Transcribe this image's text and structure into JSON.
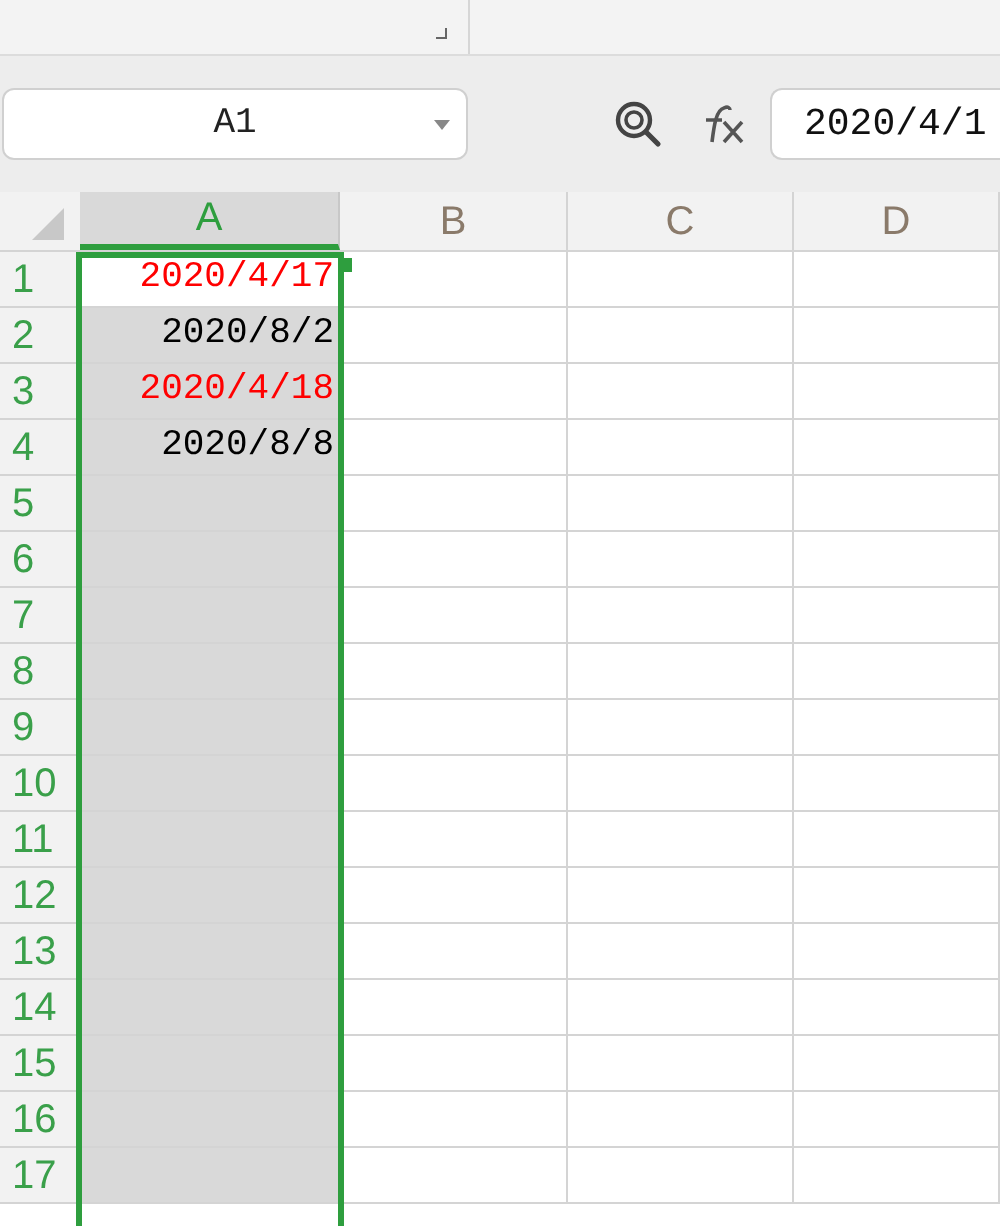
{
  "formula_bar": {
    "name_box": "A1",
    "formula": "2020/4/1"
  },
  "columns": [
    {
      "label": "A",
      "selected": true
    },
    {
      "label": "B",
      "selected": false
    },
    {
      "label": "C",
      "selected": false
    },
    {
      "label": "D",
      "selected": false
    }
  ],
  "rows": [
    {
      "header": "1",
      "cells": [
        {
          "text": "2020/4/17",
          "color": "#ff0000",
          "active": true
        }
      ]
    },
    {
      "header": "2",
      "cells": [
        {
          "text": "2020/8/2",
          "color": "#000000",
          "active": false
        }
      ]
    },
    {
      "header": "3",
      "cells": [
        {
          "text": "2020/4/18",
          "color": "#ff0000",
          "active": false
        }
      ]
    },
    {
      "header": "4",
      "cells": [
        {
          "text": "2020/8/8",
          "color": "#000000",
          "active": false
        }
      ]
    },
    {
      "header": "5"
    },
    {
      "header": "6"
    },
    {
      "header": "7"
    },
    {
      "header": "8"
    },
    {
      "header": "9"
    },
    {
      "header": "10"
    },
    {
      "header": "11"
    },
    {
      "header": "12"
    },
    {
      "header": "13"
    },
    {
      "header": "14"
    },
    {
      "header": "15"
    },
    {
      "header": "16"
    },
    {
      "header": "17"
    }
  ]
}
